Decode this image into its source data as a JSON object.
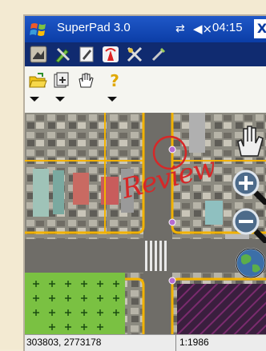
{
  "window": {
    "title": "SuperPad 3.0",
    "time": "04:15",
    "close_label": "X",
    "sync_icon": "sync-arrows-icon",
    "volume_icon": "speaker-muted-icon"
  },
  "toolbar_main": {
    "items": [
      "map-layer-icon",
      "edit-tools-icon",
      "pen-icon",
      "gps-signal-icon",
      "gps-tools-icon",
      "settings-icon"
    ]
  },
  "toolbar_secondary": {
    "items": [
      "open-folder-icon",
      "add-layer-icon",
      "select-hand-icon",
      "help-icon"
    ],
    "help_label": "?"
  },
  "map": {
    "annotation": "Review",
    "annotation_color": "#d62828",
    "road_color": "#f2b200",
    "grass_color": "#7ac142",
    "hatch_color": "#7b2b6e",
    "controls": [
      "pan-hand-icon",
      "zoom-in-icon",
      "zoom-out-icon",
      "globe-icon"
    ]
  },
  "statusbar": {
    "coordinates": "303803, 2773178",
    "scale": "1:1986"
  },
  "colors": {
    "titlebar": "#0b3da6",
    "toolbar_dark": "#102b70"
  }
}
